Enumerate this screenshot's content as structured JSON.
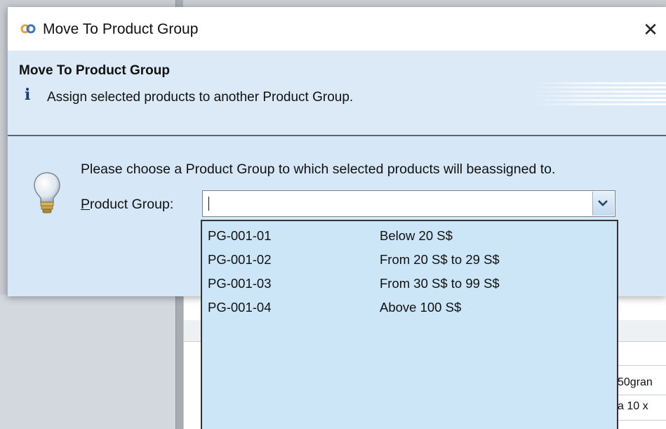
{
  "dialog": {
    "title": "Move To Product Group",
    "close_glyph": "✕",
    "header_title": "Move To Product Group",
    "info_icon": "i",
    "header_description": "Assign selected products to another Product Group.",
    "prompt": "Please choose a Product Group to which selected products will beassigned to.",
    "field_label_accel": "P",
    "field_label_rest": "roduct Group:",
    "combo_value": ""
  },
  "dropdown": {
    "items": [
      {
        "code": "PG-001-01",
        "description": "Below 20 S$"
      },
      {
        "code": "PG-001-02",
        "description": "From 20 S$ to 29 S$"
      },
      {
        "code": "PG-001-03",
        "description": "From 30 S$ to 99 S$"
      },
      {
        "code": "PG-001-04",
        "description": "Above 100 S$"
      }
    ]
  },
  "background": {
    "cell_1": "50gran",
    "cell_2": "a 10 x"
  },
  "colors": {
    "dialog_bg": "#d6e8f7",
    "dropdown_bg": "#cde6f7",
    "title_icon_orange": "#e8a33a",
    "title_icon_blue": "#3a76c8",
    "info_blue": "#1d3d7a"
  },
  "icons": {
    "title": "link-chain-icon",
    "info": "info-icon",
    "hint": "lightbulb-icon",
    "combo": "chevron-down-icon",
    "close": "close-icon"
  }
}
